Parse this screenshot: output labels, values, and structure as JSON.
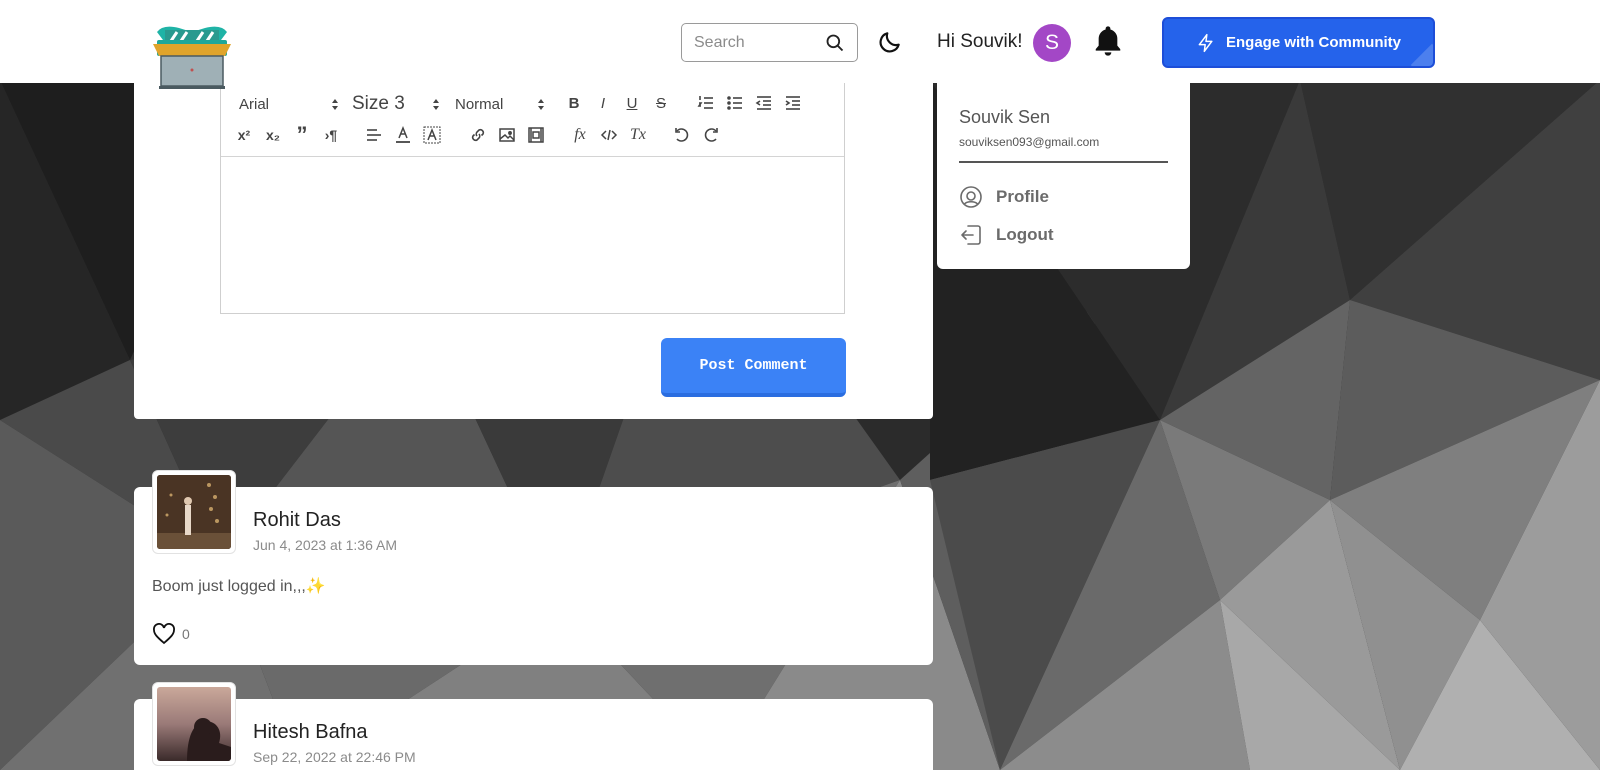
{
  "header": {
    "search_placeholder": "Search",
    "greeting": "Hi Souvik!",
    "avatar_initial": "S",
    "engage_label": "Engage with Community"
  },
  "editor": {
    "font": "Arial",
    "size": "Size 3",
    "heading": "Normal",
    "post_button": "Post Comment"
  },
  "user_menu": {
    "name": "Souvik Sen",
    "email": "souviksen093@gmail.com",
    "items": [
      {
        "label": "Profile",
        "icon": "profile-circle-icon"
      },
      {
        "label": "Logout",
        "icon": "logout-icon"
      }
    ]
  },
  "comments": [
    {
      "author": "Rohit Das",
      "date": "Jun 4, 2023 at 1:36 AM",
      "text": "Boom just logged in,,,✨",
      "likes": "0"
    },
    {
      "author": "Hitesh Bafna",
      "date": "Sep 22, 2022 at 22:46 PM"
    }
  ],
  "colors": {
    "accent": "#2563eb",
    "post_button": "#3b82f6",
    "avatar": "#a347c6"
  }
}
